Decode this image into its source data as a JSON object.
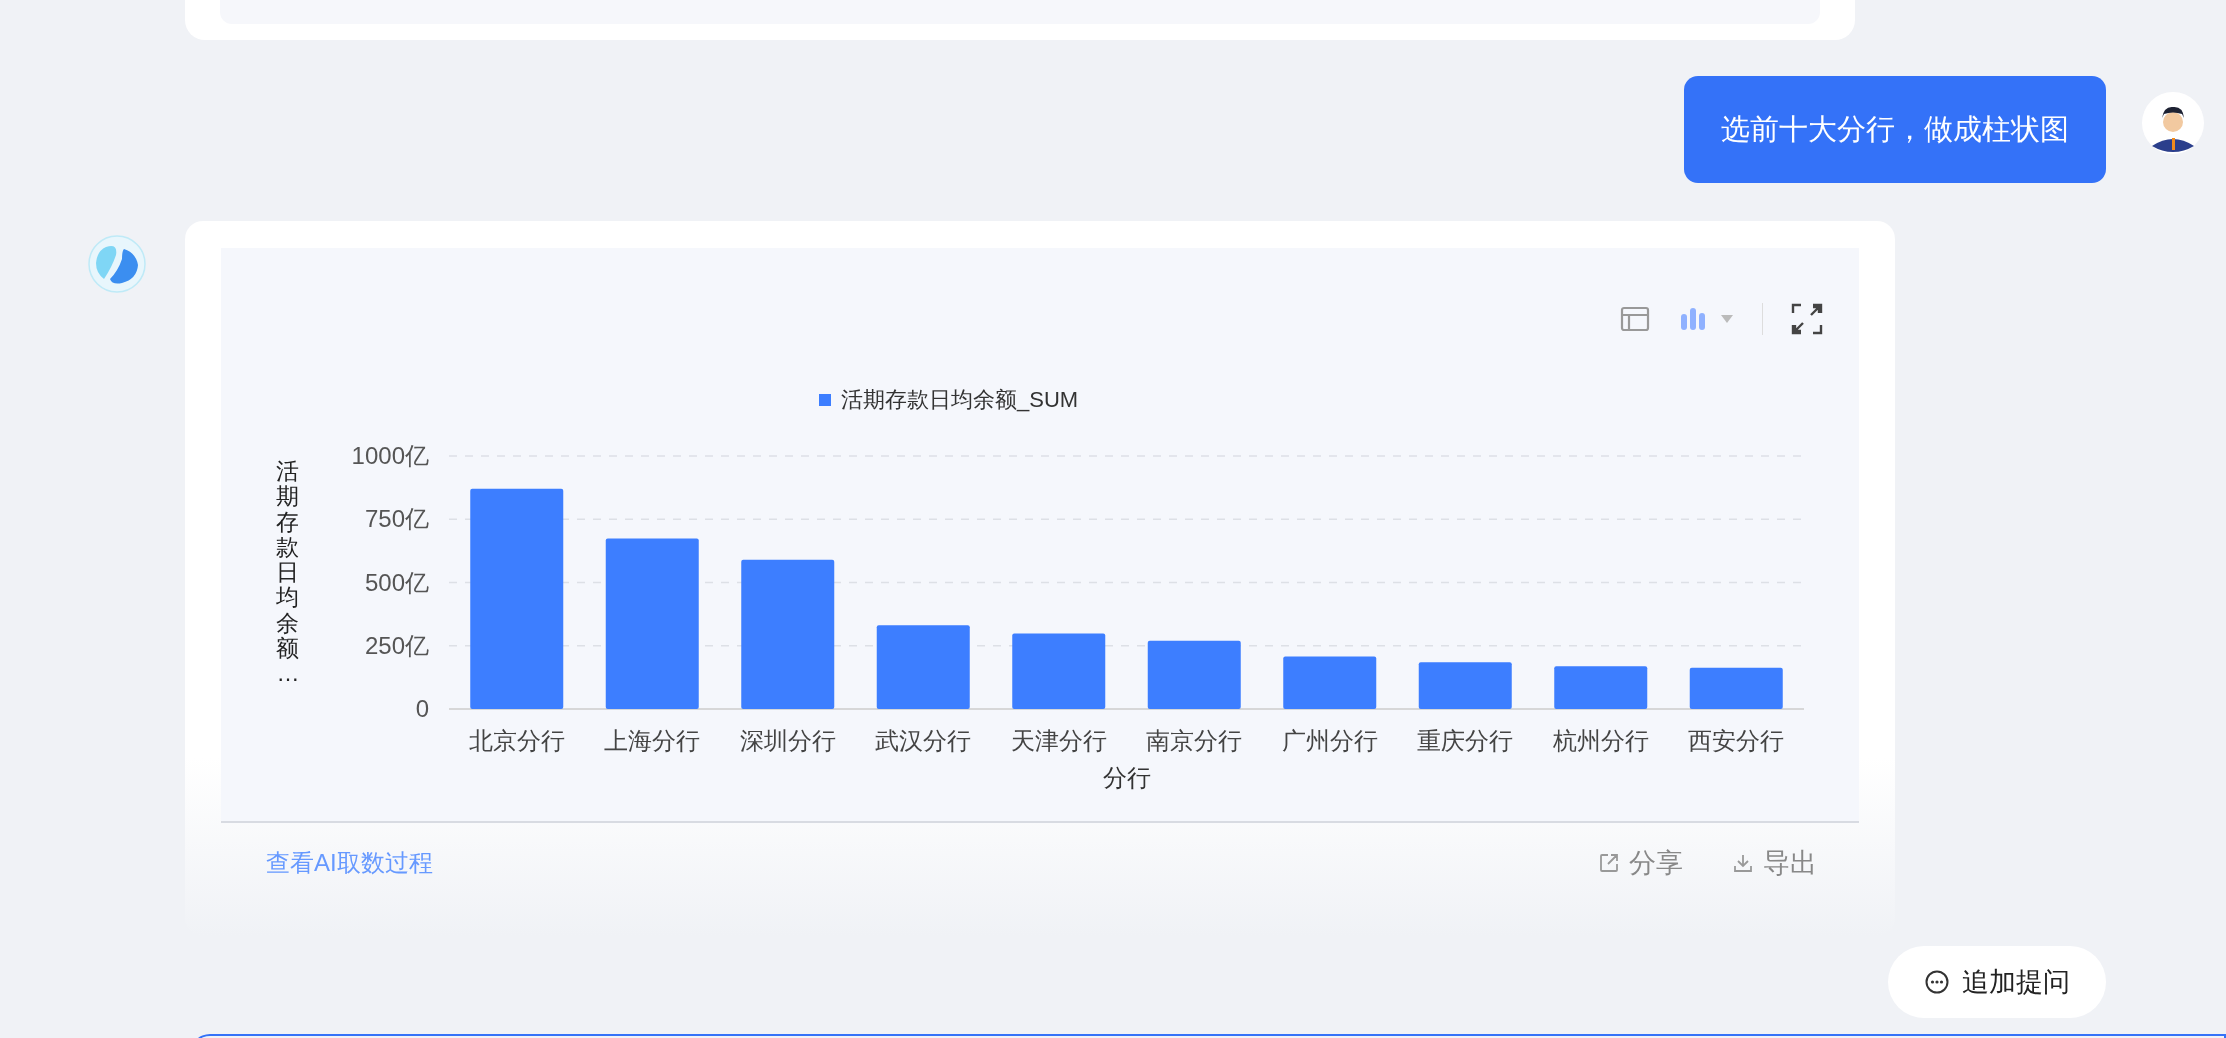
{
  "user_message": {
    "text": "选前十大分行，做成柱状图"
  },
  "answer": {
    "chart_data": {
      "type": "bar",
      "xlabel": "分行",
      "ylabel": "活期存款日均余额…",
      "categories": [
        "北京分行",
        "上海分行",
        "深圳分行",
        "武汉分行",
        "天津分行",
        "南京分行",
        "广州分行",
        "重庆分行",
        "杭州分行",
        "西安分行"
      ],
      "series": [
        {
          "name": "活期存款日均余额_SUM",
          "color": "#3d7eff",
          "values": [
            871,
            674,
            590,
            331,
            298,
            270,
            208,
            185,
            169,
            163
          ]
        }
      ],
      "ylim": [
        0,
        1000
      ],
      "grid": true,
      "yticks": [
        {
          "value": 0,
          "label": "0"
        },
        {
          "value": 250,
          "label": "250亿"
        },
        {
          "value": 500,
          "label": "500亿"
        },
        {
          "value": 750,
          "label": "750亿"
        },
        {
          "value": 1000,
          "label": "1000亿"
        }
      ]
    },
    "link": "查看AI取数过程",
    "actions": [
      {
        "kind": "share",
        "label": "分享"
      },
      {
        "kind": "export",
        "label": "导出"
      }
    ]
  },
  "follow_up_button": {
    "label": "追加提问"
  }
}
